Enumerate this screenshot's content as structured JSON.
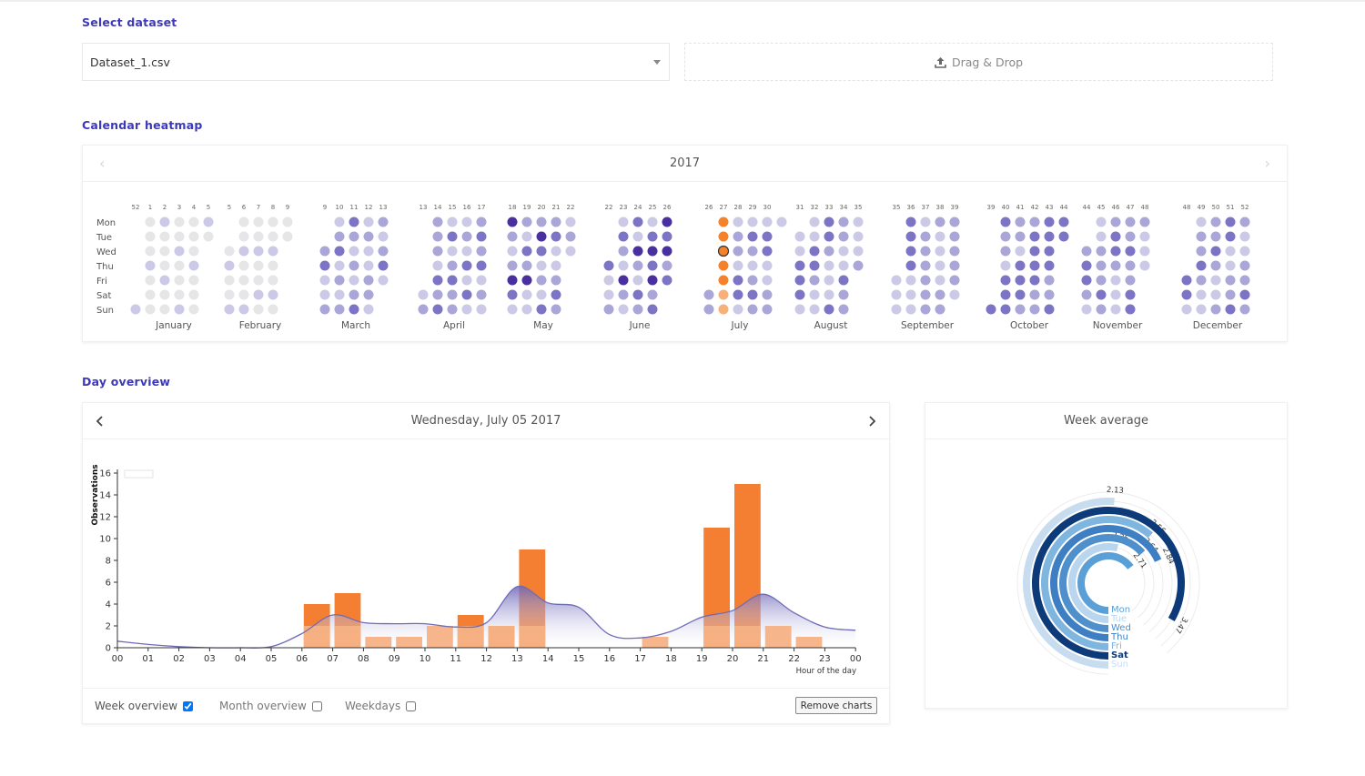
{
  "dataset": {
    "title": "Select dataset",
    "selected": "Dataset_1.csv",
    "dropzone_label": "Drag & Drop"
  },
  "heatmap": {
    "title": "Calendar heatmap",
    "year": "2017",
    "weekdays": [
      "Mon",
      "Tue",
      "Wed",
      "Thu",
      "Fri",
      "Sat",
      "Sun"
    ],
    "months": [
      "January",
      "February",
      "March",
      "April",
      "May",
      "June",
      "July",
      "August",
      "September",
      "October",
      "November",
      "December"
    ],
    "week_labels": [
      [
        "52",
        "1",
        "2",
        "3",
        "4",
        "5"
      ],
      [
        "5",
        "6",
        "7",
        "8",
        "9"
      ],
      [
        "9",
        "10",
        "11",
        "12",
        "13"
      ],
      [
        "13",
        "14",
        "15",
        "16",
        "17"
      ],
      [
        "18",
        "19",
        "20",
        "21",
        "22"
      ],
      [
        "22",
        "23",
        "24",
        "25",
        "26"
      ],
      [
        "26",
        "27",
        "28",
        "29",
        "30"
      ],
      [
        "31",
        "32",
        "33",
        "34",
        "35"
      ],
      [
        "35",
        "36",
        "37",
        "38",
        "39"
      ],
      [
        "39",
        "40",
        "41",
        "42",
        "43",
        "44"
      ],
      [
        "44",
        "45",
        "46",
        "47",
        "48"
      ],
      [
        "48",
        "49",
        "50",
        "51",
        "52"
      ]
    ],
    "colors": {
      "empty": "#e6e6e8",
      "low": "#cbc9e6",
      "mid": "#aaa6d8",
      "high": "#7c74c4",
      "max": "#4a2fa0",
      "selected": "#f5822a",
      "selected_light": "#f7b07a"
    }
  },
  "day_overview": {
    "title": "Day overview",
    "date_label": "Wednesday, July 05 2017",
    "options": [
      {
        "label": "Week overview",
        "checked": true
      },
      {
        "label": "Month overview",
        "checked": false
      },
      {
        "label": "Weekdays",
        "checked": false
      }
    ],
    "remove_label": "Remove charts"
  },
  "week_average": {
    "title": "Week average",
    "colors": {
      "Mon": "#5aa0d6",
      "Tue": "#b9d6ee",
      "Wed": "#4f8fcb",
      "Thu": "#3e7ec2",
      "Fri": "#7eb6e0",
      "Sat": "#0d3a78",
      "Sun": "#c8dcf0"
    }
  },
  "chart_data": [
    {
      "type": "bar",
      "title": "",
      "xlabel": "Hour of the day",
      "ylabel": "Observations",
      "ylim": [
        0,
        16
      ],
      "yticks": [
        "0",
        "2",
        "4",
        "6",
        "8",
        "10",
        "12",
        "14",
        "16"
      ],
      "categories": [
        "00",
        "01",
        "02",
        "03",
        "04",
        "05",
        "06",
        "07",
        "08",
        "09",
        "10",
        "11",
        "12",
        "13",
        "14",
        "15",
        "16",
        "17",
        "18",
        "19",
        "20",
        "21",
        "22",
        "23",
        "00"
      ],
      "series": [
        {
          "values": [
            0,
            0,
            0,
            0,
            0,
            0,
            4,
            5,
            0,
            0,
            0,
            3,
            2,
            9,
            0,
            0,
            0,
            0,
            0,
            11,
            15,
            0,
            0,
            0
          ]
        },
        {
          "values": [
            0,
            0,
            0,
            0,
            0,
            0,
            2,
            2,
            1,
            1,
            2,
            2,
            2,
            2,
            0,
            0,
            0,
            1,
            0,
            2,
            2,
            2,
            1,
            0
          ]
        }
      ],
      "average_curve": [
        0.6,
        0.3,
        0.1,
        0,
        0,
        0.1,
        1.3,
        3,
        2.3,
        2.2,
        2.2,
        1.9,
        2.3,
        5.6,
        4.1,
        3.7,
        1.2,
        0.9,
        1.5,
        2.8,
        3.4,
        4.9,
        3.2,
        1.9,
        1.6
      ]
    },
    {
      "type": "bar",
      "title": "Week average",
      "categories": [
        "Mon",
        "Tue",
        "Wed",
        "Thu",
        "Fri",
        "Sat",
        "Sun"
      ],
      "values": [
        2.71,
        2.25,
        2.64,
        2.84,
        2.56,
        3.47,
        2.13
      ]
    }
  ]
}
